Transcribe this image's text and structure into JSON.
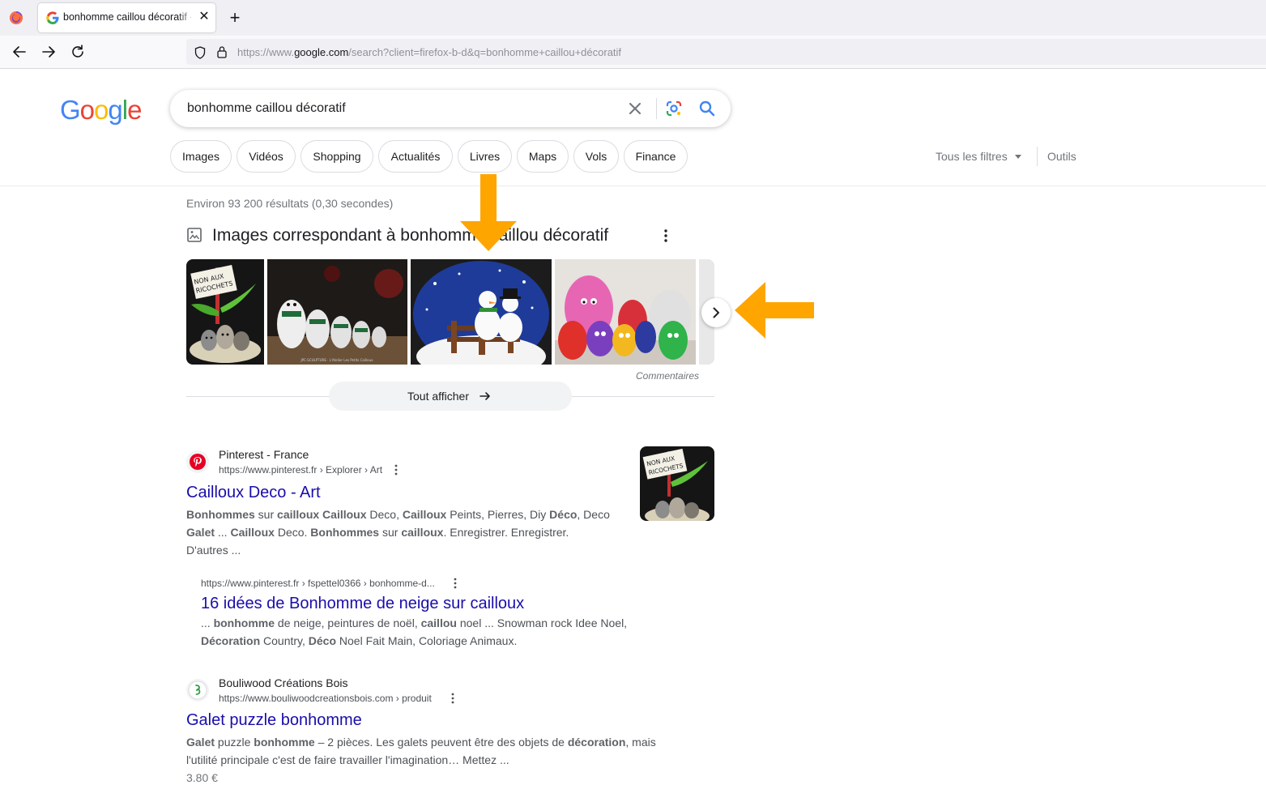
{
  "browser": {
    "tab_title": "bonhomme caillou décoratif - Recherche Google",
    "new_tab_label": "+",
    "url_prefix": "https://www.",
    "url_domain": "google.com",
    "url_path": "/search?client=firefox-b-d&q=bonhomme+caillou+décoratif"
  },
  "google": {
    "logo": [
      "G",
      "o",
      "o",
      "g",
      "l",
      "e"
    ],
    "logo_colors": [
      "#4285F4",
      "#EA4335",
      "#FBBC05",
      "#4285F4",
      "#34A853",
      "#EA4335"
    ],
    "query": "bonhomme caillou décoratif",
    "chips": [
      "Images",
      "Vidéos",
      "Shopping",
      "Actualités",
      "Livres",
      "Maps",
      "Vols",
      "Finance"
    ],
    "all_filters": "Tous les filtres",
    "tools": "Outils",
    "stats": "Environ 93 200 résultats (0,30 secondes)"
  },
  "images_section": {
    "title": "Images correspondant à bonhomme caillou décoratif",
    "feedback": "Commentaires",
    "show_all": "Tout afficher",
    "thumb1_sign": [
      "NON AUX",
      "RICOCHETS"
    ],
    "thumb2_caption": "JPC-SCULPTURE · L'Atelier Les Petits Cailloux"
  },
  "results": [
    {
      "site_name": "Pinterest - France",
      "url": "https://www.pinterest.fr › Explorer › Art",
      "title": "Cailloux Deco - Art",
      "snippet_lines": [
        [
          [
            "b",
            "Bonhommes"
          ],
          [
            "t",
            " sur "
          ],
          [
            "b",
            "cailloux Cailloux"
          ],
          [
            "t",
            " Deco, "
          ],
          [
            "b",
            "Cailloux"
          ],
          [
            "t",
            " Peints, Pierres, Diy "
          ],
          [
            "b",
            "Déco"
          ],
          [
            "t",
            ", Deco"
          ]
        ],
        [
          [
            "b",
            "Galet"
          ],
          [
            "t",
            " ... "
          ],
          [
            "b",
            "Cailloux"
          ],
          [
            "t",
            " Deco. "
          ],
          [
            "b",
            "Bonhommes"
          ],
          [
            "t",
            " sur "
          ],
          [
            "b",
            "cailloux"
          ],
          [
            "t",
            ". Enregistrer. Enregistrer."
          ]
        ],
        [
          [
            "t",
            "D'autres ..."
          ]
        ]
      ],
      "thumb_sign": [
        "NON AUX",
        "RICOCHETS"
      ]
    },
    {
      "url": "https://www.pinterest.fr › fspettel0366 › bonhomme-d...",
      "title": "16 idées de Bonhomme de neige sur cailloux",
      "snippet_lines": [
        [
          [
            "t",
            "... "
          ],
          [
            "b",
            "bonhomme"
          ],
          [
            "t",
            " de neige, peintures de noël, "
          ],
          [
            "b",
            "caillou"
          ],
          [
            "t",
            " noel ... Snowman rock Idee Noel,"
          ]
        ],
        [
          [
            "b",
            "Décoration"
          ],
          [
            "t",
            " Country, "
          ],
          [
            "b",
            "Déco"
          ],
          [
            "t",
            " Noel Fait Main, Coloriage Animaux."
          ]
        ]
      ]
    },
    {
      "site_name": "Bouliwood Créations Bois",
      "url": "https://www.bouliwoodcreationsbois.com › produit",
      "title": "Galet puzzle bonhomme",
      "snippet_lines": [
        [
          [
            "b",
            "Galet"
          ],
          [
            "t",
            " puzzle "
          ],
          [
            "b",
            "bonhomme"
          ],
          [
            "t",
            " – 2 pièces. Les galets peuvent être des objets de "
          ],
          [
            "b",
            "décoration"
          ],
          [
            "t",
            ", mais"
          ]
        ],
        [
          [
            "t",
            "l'utilité principale c'est de faire travailler l'imagination… Mettez ..."
          ]
        ]
      ],
      "price": "3.80 €"
    }
  ],
  "colors": {
    "link": "#1a0dab",
    "annotation_arrow": "#FFA500"
  }
}
